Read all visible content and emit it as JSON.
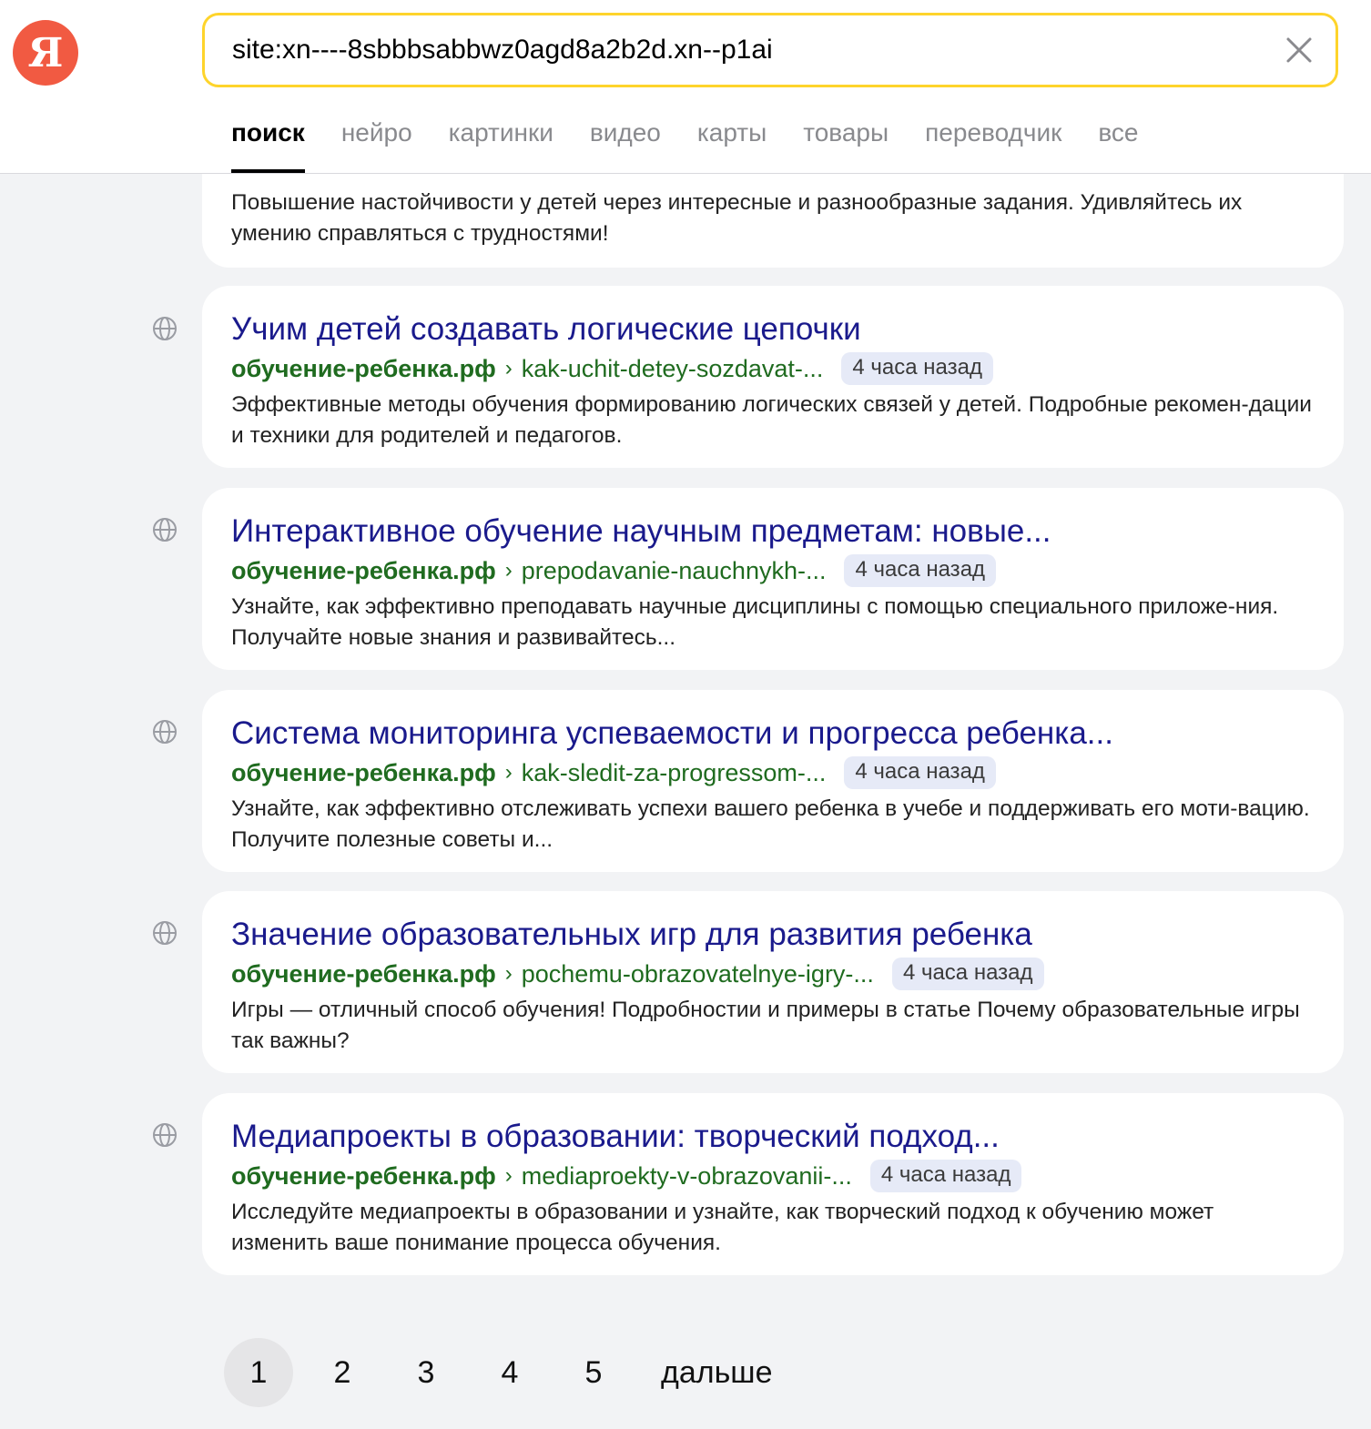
{
  "header": {
    "logo_letter": "Я",
    "search": {
      "value": "site:xn----8sbbbsabbwz0agd8a2b2d.xn--p1ai",
      "clear_icon": "close-icon"
    },
    "tabs": [
      {
        "label": "поиск",
        "active": true
      },
      {
        "label": "нейро"
      },
      {
        "label": "картинки"
      },
      {
        "label": "видео"
      },
      {
        "label": "карты"
      },
      {
        "label": "товары"
      },
      {
        "label": "переводчик"
      },
      {
        "label": "все"
      }
    ]
  },
  "results": {
    "partial": {
      "snippet": "Повышение настойчивости у детей через интересные и разнообразные задания. Удивляйтесь их умению справляться с трудностями!"
    },
    "items": [
      {
        "title": "Учим детей создавать логические цепочки",
        "domain": "обучение-ребенка.рф",
        "path": "kak-uchit-detey-sozdavat-...",
        "age": "4 часа назад",
        "snippet": "Эффективные методы обучения формированию логических связей у детей. Подробные рекомен-дации и техники для родителей и педагогов."
      },
      {
        "title": "Интерактивное обучение научным предметам: новые...",
        "domain": "обучение-ребенка.рф",
        "path": "prepodavanie-nauchnykh-...",
        "age": "4 часа назад",
        "snippet": "Узнайте, как эффективно преподавать научные дисциплины с помощью специального приложе-ния. Получайте новые знания и развивайтесь..."
      },
      {
        "title": "Система мониторинга успеваемости и прогресса ребенка...",
        "domain": "обучение-ребенка.рф",
        "path": "kak-sledit-za-progressom-...",
        "age": "4 часа назад",
        "snippet": "Узнайте, как эффективно отслеживать успехи вашего ребенка в учебе и поддерживать его моти-вацию. Получите полезные советы и..."
      },
      {
        "title": "Значение образовательных игр для развития ребенка",
        "domain": "обучение-ребенка.рф",
        "path": "pochemu-obrazovatelnye-igry-...",
        "age": "4 часа назад",
        "snippet": "Игры — отличный способ обучения! Подробностии и примеры в статье Почему образовательные игры так важны?"
      },
      {
        "title": "Медиапроекты в образовании: творческий подход...",
        "domain": "обучение-ребенка.рф",
        "path": "mediaproekty-v-obrazovanii-...",
        "age": "4 часа назад",
        "snippet": "Исследуйте медиапроекты в образовании и узнайте, как творческий подход к обучению может изменить ваше понимание процесса обучения."
      }
    ]
  },
  "pagination": {
    "pages": [
      "1",
      "2",
      "3",
      "4",
      "5"
    ],
    "current": "1",
    "next_label": "дальше"
  },
  "colors": {
    "logo": "#f15a42",
    "search_border": "#fed42b",
    "title_link": "#1a1a8c",
    "url_green": "#1f6b1f",
    "badge_bg": "#e6eaf7",
    "page_bg": "#f2f3f5"
  }
}
